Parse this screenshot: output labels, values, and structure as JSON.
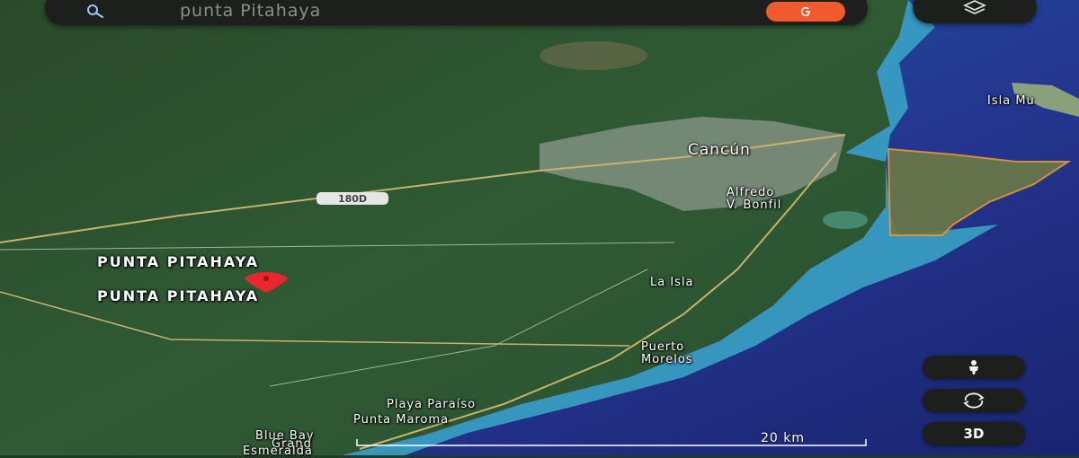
{
  "search": {
    "query": "punta Pitahaya",
    "search_icon": "search-icon",
    "go_icon": "google-g-icon"
  },
  "controls": {
    "layers_icon": "layers-icon",
    "street_view_icon": "pegman-icon",
    "rotate_icon": "rotate-arrows-icon",
    "view_3d_label": "3D"
  },
  "map": {
    "place_label_top": "PUNTA PITAHAYA",
    "place_label_bottom": "PUNTA PITAHAYA",
    "marker_color": "#e8262c",
    "highway_shield": "180D",
    "places": {
      "cancun": "Cancún",
      "alfredo": "Alfredo\nV. Bonfil",
      "isla_mujeres": "Isla Mu",
      "la_isla": "La Isla",
      "puerto_morelos": "Puerto\nMorelos",
      "playa_paraiso": "Playa Paraíso",
      "punta_maroma": "Punta Maroma",
      "blue_bay": "Blue Bay",
      "grand": "Grand",
      "esmeralda": "Esmeralda"
    },
    "highlight_color": "#e8963a",
    "scale": "20 km"
  },
  "colors": {
    "land": "#2b5230",
    "sea_shallow": "#3aa8c8",
    "sea_deep": "#23338a",
    "accent": "#f05a2c"
  }
}
